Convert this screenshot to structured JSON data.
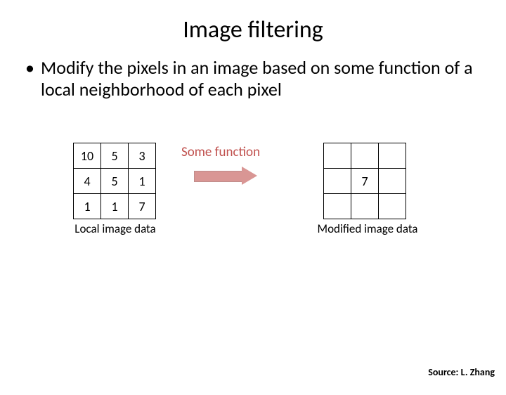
{
  "title": "Image filtering",
  "bullet": {
    "dot": "•",
    "text": "Modify the pixels in an image based on some function of a local neighborhood of each pixel"
  },
  "left_grid": {
    "r0": {
      "c0": "10",
      "c1": "5",
      "c2": "3"
    },
    "r1": {
      "c0": "4",
      "c1": "5",
      "c2": "1"
    },
    "r2": {
      "c0": "1",
      "c1": "1",
      "c2": "7"
    }
  },
  "right_grid": {
    "r0": {
      "c0": "",
      "c1": "",
      "c2": ""
    },
    "r1": {
      "c0": "",
      "c1": "7",
      "c2": ""
    },
    "r2": {
      "c0": "",
      "c1": "",
      "c2": ""
    }
  },
  "captions": {
    "left": "Local image data",
    "right": "Modified image data",
    "func": "Some function"
  },
  "source": "Source: L. Zhang"
}
